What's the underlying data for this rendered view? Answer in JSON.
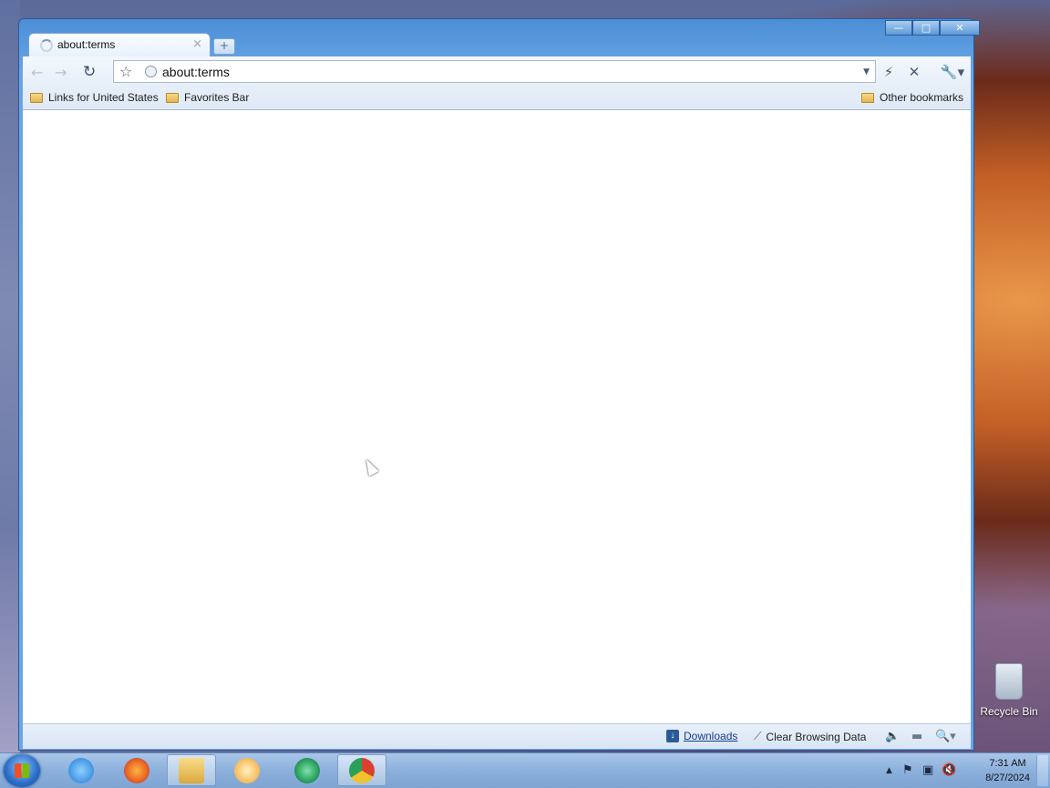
{
  "browser": {
    "tab": {
      "title": "about:terms",
      "close": "×"
    },
    "new_tab": "+",
    "toolbar": {
      "back": "←",
      "forward": "→",
      "reload": "↻",
      "url": "about:terms",
      "star": "☆",
      "dropdown": "▼",
      "lightning": "⚡",
      "stop": "✕",
      "wrench": "🔧▾"
    },
    "bookmarks": {
      "left": [
        "Links for United States",
        "Favorites Bar"
      ],
      "right": "Other bookmarks"
    },
    "statusbar": {
      "downloads": "Downloads",
      "clear": "Clear Browsing Data",
      "dl_icon": "↓",
      "broom_icon": "⟋",
      "sound_icon": "🔈",
      "device_icon": "▬",
      "zoom_icon": "🔍▾"
    },
    "window_controls": {
      "min": "—",
      "max": "□",
      "close": "✕"
    }
  },
  "desktop": {
    "recycle_bin": "Recycle Bin"
  },
  "taskbar": {
    "time": "7:31 AM",
    "date": "8/27/2024",
    "tray": {
      "arrow": "▲",
      "flag": "⚑",
      "net": "▣",
      "sound": "🔇"
    },
    "apps": [
      {
        "name": "internet-explorer",
        "color": "#1e7bd8"
      },
      {
        "name": "firefox",
        "color": "#e8631f"
      },
      {
        "name": "file-explorer",
        "color": "#f0c65a"
      },
      {
        "name": "media-player",
        "color": "#f0a030"
      },
      {
        "name": "edge-browser",
        "color": "#2aa05a"
      },
      {
        "name": "chrome",
        "color": "#d9402e"
      }
    ]
  }
}
